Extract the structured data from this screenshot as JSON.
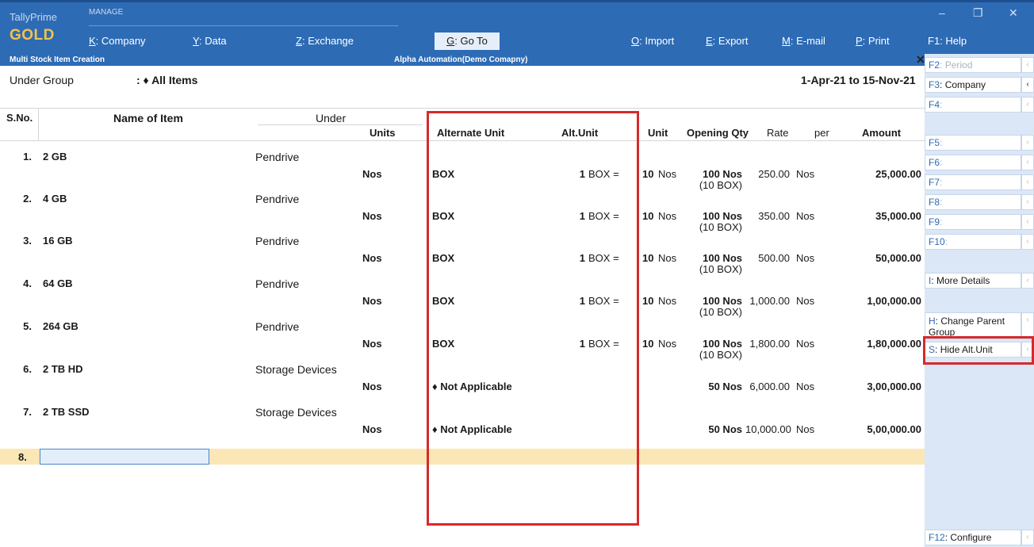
{
  "app": {
    "name": "TallyPrime",
    "edition": "GOLD",
    "manage_label": "MANAGE",
    "window_controls": [
      "–",
      "❐",
      "✕"
    ]
  },
  "menu": [
    {
      "key": "K",
      "label": "Company"
    },
    {
      "key": "Y",
      "label": "Data"
    },
    {
      "key": "Z",
      "label": "Exchange"
    },
    {
      "key": "G",
      "label": "Go To"
    },
    {
      "key": "O",
      "label": "Import"
    },
    {
      "key": "E",
      "label": "Export"
    },
    {
      "key": "M",
      "label": "E-mail"
    },
    {
      "key": "P",
      "label": "Print"
    },
    {
      "key": "F1",
      "label": "Help"
    }
  ],
  "screen": {
    "title": "Multi Stock Item  Creation",
    "company": "Alpha Automation(Demo Comapny)",
    "close": "✕",
    "under_group_label": "Under Group",
    "under_group_value": ": ♦ All Items",
    "period": "1-Apr-21 to 15-Nov-21"
  },
  "columns": {
    "sno": "S.No.",
    "name": "Name of Item",
    "under": "Under",
    "units": "Units",
    "alt_unit": "Alternate Unit",
    "alt_conv": "Alt.Unit",
    "unit": "Unit",
    "opening_qty": "Opening Qty",
    "rate": "Rate",
    "per": "per",
    "amount": "Amount"
  },
  "rows": [
    {
      "sno": "1.",
      "name": "2 GB",
      "under": "Pendrive",
      "units": "Nos",
      "alt_unit": "BOX",
      "alt_num": "1",
      "alt_eq": "BOX =",
      "conv_num": "10",
      "conv_unit": "Nos",
      "qty": "100 Nos",
      "qty_alt": "(10 BOX)",
      "rate": "250.00",
      "per": "Nos",
      "amount": "25,000.00"
    },
    {
      "sno": "2.",
      "name": "4 GB",
      "under": "Pendrive",
      "units": "Nos",
      "alt_unit": "BOX",
      "alt_num": "1",
      "alt_eq": "BOX =",
      "conv_num": "10",
      "conv_unit": "Nos",
      "qty": "100 Nos",
      "qty_alt": "(10 BOX)",
      "rate": "350.00",
      "per": "Nos",
      "amount": "35,000.00"
    },
    {
      "sno": "3.",
      "name": "16 GB",
      "under": "Pendrive",
      "units": "Nos",
      "alt_unit": "BOX",
      "alt_num": "1",
      "alt_eq": "BOX =",
      "conv_num": "10",
      "conv_unit": "Nos",
      "qty": "100 Nos",
      "qty_alt": "(10 BOX)",
      "rate": "500.00",
      "per": "Nos",
      "amount": "50,000.00"
    },
    {
      "sno": "4.",
      "name": "64 GB",
      "under": "Pendrive",
      "units": "Nos",
      "alt_unit": "BOX",
      "alt_num": "1",
      "alt_eq": "BOX =",
      "conv_num": "10",
      "conv_unit": "Nos",
      "qty": "100 Nos",
      "qty_alt": "(10 BOX)",
      "rate": "1,000.00",
      "per": "Nos",
      "amount": "1,00,000.00"
    },
    {
      "sno": "5.",
      "name": "264 GB",
      "under": "Pendrive",
      "units": "Nos",
      "alt_unit": "BOX",
      "alt_num": "1",
      "alt_eq": "BOX =",
      "conv_num": "10",
      "conv_unit": "Nos",
      "qty": "100 Nos",
      "qty_alt": "(10 BOX)",
      "rate": "1,800.00",
      "per": "Nos",
      "amount": "1,80,000.00"
    },
    {
      "sno": "6.",
      "name": "2 TB HD",
      "under": "Storage Devices",
      "units": "Nos",
      "alt_unit": "♦ Not Applicable",
      "alt_num": "",
      "alt_eq": "",
      "conv_num": "",
      "conv_unit": "",
      "qty": "50 Nos",
      "qty_alt": "",
      "rate": "6,000.00",
      "per": "Nos",
      "amount": "3,00,000.00"
    },
    {
      "sno": "7.",
      "name": "2 TB SSD",
      "under": "Storage Devices",
      "units": "Nos",
      "alt_unit": "♦ Not Applicable",
      "alt_num": "",
      "alt_eq": "",
      "conv_num": "",
      "conv_unit": "",
      "qty": "50 Nos",
      "qty_alt": "",
      "rate": "10,000.00",
      "per": "Nos",
      "amount": "5,00,000.00"
    }
  ],
  "new_row": {
    "sno": "8.",
    "name_value": ""
  },
  "side_buttons": [
    {
      "key": "F2",
      "label": "Period",
      "enabled": false
    },
    {
      "key": "F3",
      "label": "Company",
      "enabled": true
    },
    {
      "key": "F4",
      "label": "",
      "enabled": false
    },
    {
      "key": "F5",
      "label": "",
      "enabled": false
    },
    {
      "key": "F6",
      "label": "",
      "enabled": false
    },
    {
      "key": "F7",
      "label": "",
      "enabled": false
    },
    {
      "key": "F8",
      "label": "",
      "enabled": false
    },
    {
      "key": "F9",
      "label": "",
      "enabled": false
    },
    {
      "key": "F10",
      "label": "",
      "enabled": false
    },
    {
      "key": "I",
      "label": "More Details",
      "enabled": true
    },
    {
      "key": "H",
      "label": "Change Parent Group",
      "enabled": true
    },
    {
      "key": "S",
      "label": "Hide Alt.Unit",
      "enabled": true
    },
    {
      "key": "F12",
      "label": "Configure",
      "enabled": true
    }
  ],
  "colors": {
    "topbar": "#2d6bb5",
    "gold": "#f5c24a",
    "highlight": "#d62a2a",
    "new_row": "#fbe6b5"
  }
}
